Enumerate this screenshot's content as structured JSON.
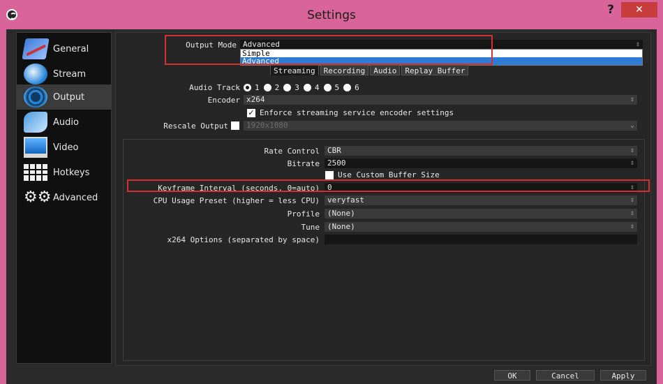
{
  "window": {
    "title": "Settings",
    "help": "?",
    "close": "✕"
  },
  "sidebar": {
    "items": [
      {
        "label": "General",
        "icon": "general-icon"
      },
      {
        "label": "Stream",
        "icon": "stream-icon"
      },
      {
        "label": "Output",
        "icon": "output-icon",
        "active": true
      },
      {
        "label": "Audio",
        "icon": "audio-icon"
      },
      {
        "label": "Video",
        "icon": "video-icon"
      },
      {
        "label": "Hotkeys",
        "icon": "hotkeys-icon"
      },
      {
        "label": "Advanced",
        "icon": "advanced-icon"
      }
    ]
  },
  "output_mode": {
    "label": "Output Mode",
    "value": "Advanced",
    "options": [
      "Simple",
      "Advanced"
    ],
    "selected_option": "Advanced"
  },
  "tabs": [
    "Streaming",
    "Recording",
    "Audio",
    "Replay Buffer"
  ],
  "audio_track": {
    "label": "Audio Track",
    "options": [
      "1",
      "2",
      "3",
      "4",
      "5",
      "6"
    ],
    "selected": "1"
  },
  "encoder": {
    "label": "Encoder",
    "value": "x264"
  },
  "enforce": {
    "label": "Enforce streaming service encoder settings",
    "checked": true
  },
  "rescale": {
    "label": "Rescale Output",
    "value": "1920x1080",
    "checked": false
  },
  "rate_control": {
    "label": "Rate Control",
    "value": "CBR"
  },
  "bitrate": {
    "label": "Bitrate",
    "value": "2500"
  },
  "custom_buffer": {
    "label": "Use Custom Buffer Size",
    "checked": false
  },
  "keyframe": {
    "label": "Keyframe Interval (seconds, 0=auto)",
    "value": "0"
  },
  "cpu_preset": {
    "label": "CPU Usage Preset (higher = less CPU)",
    "value": "veryfast"
  },
  "profile": {
    "label": "Profile",
    "value": "(None)"
  },
  "tune": {
    "label": "Tune",
    "value": "(None)"
  },
  "x264_options": {
    "label": "x264 Options (separated by space)",
    "value": ""
  },
  "buttons": {
    "ok": "OK",
    "cancel": "Cancel",
    "apply": "Apply"
  },
  "colors": {
    "highlight": "#d43030",
    "titlebar": "#d8649a",
    "selection": "#2e7bd6"
  }
}
